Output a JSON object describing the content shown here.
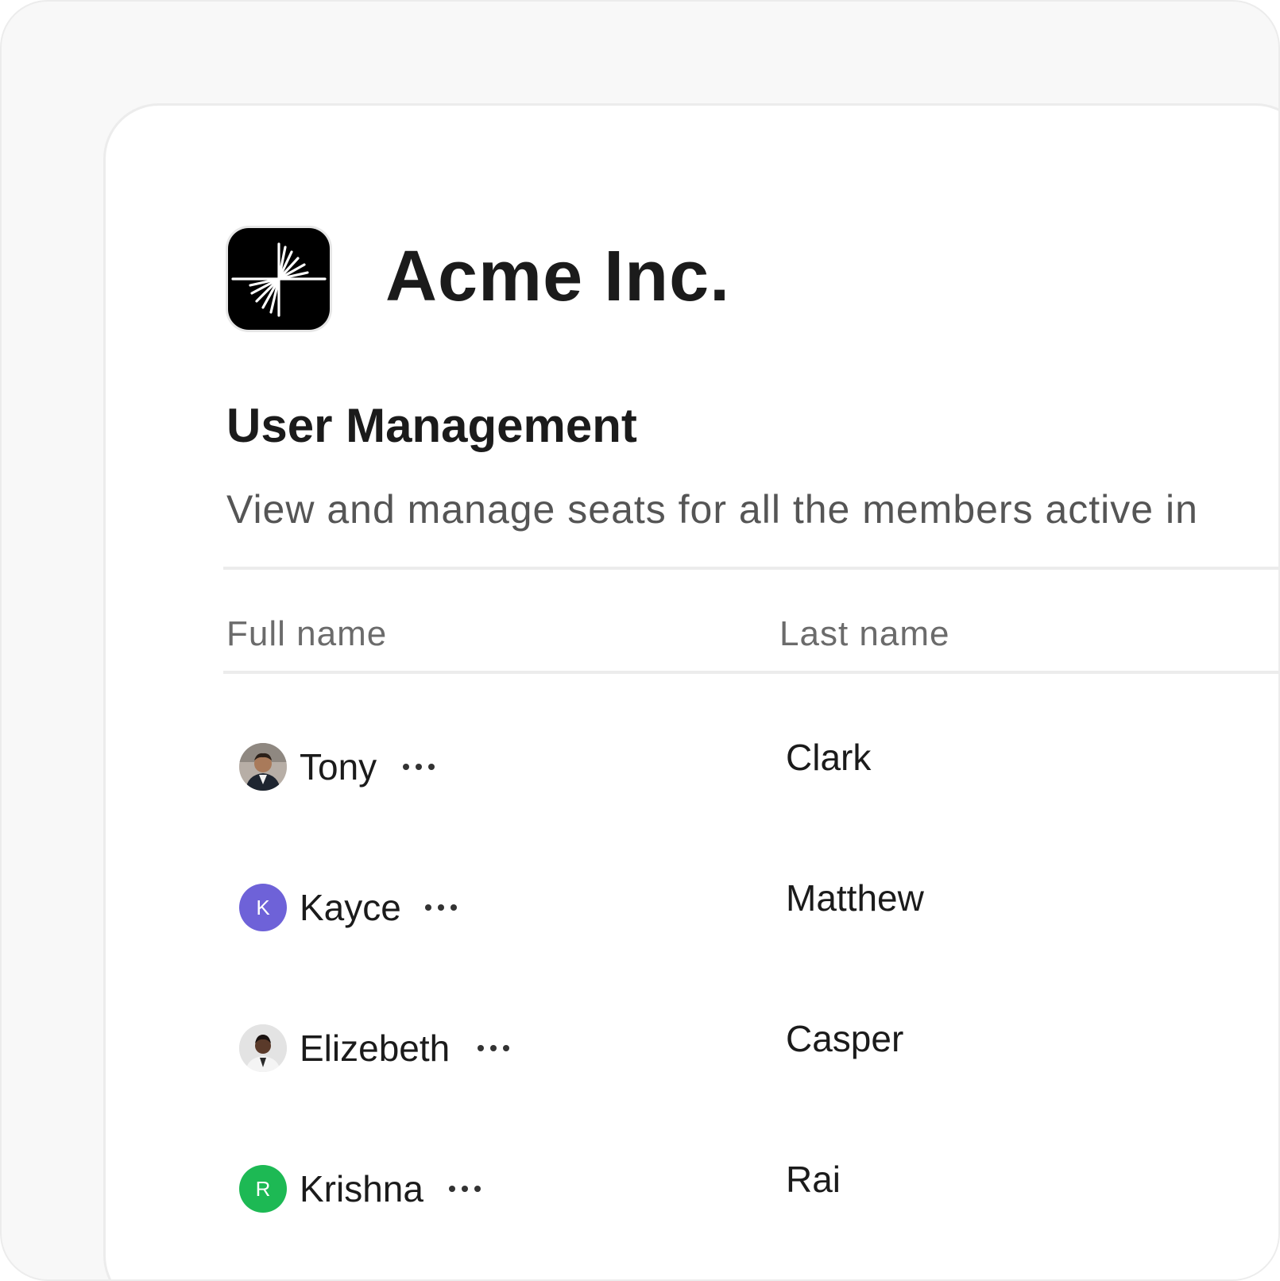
{
  "brand": {
    "company_name": "Acme Inc.",
    "logo_icon": "starburst-logo-icon"
  },
  "section": {
    "title": "User Management",
    "description": "View and manage seats for all the members active in"
  },
  "table": {
    "columns": [
      "Full name",
      "Last name"
    ],
    "rows": [
      {
        "first": "Tony",
        "last": "Clark",
        "avatar_type": "photo",
        "avatar_initial": ""
      },
      {
        "first": "Kayce",
        "last": "Matthew",
        "avatar_type": "initial",
        "avatar_initial": "K",
        "avatar_color": "#6e62d8"
      },
      {
        "first": "Elizebeth",
        "last": "Casper",
        "avatar_type": "photo",
        "avatar_initial": ""
      },
      {
        "first": "Krishna",
        "last": "Rai",
        "avatar_type": "initial",
        "avatar_initial": "R",
        "avatar_color": "#1db954"
      }
    ],
    "row_action_icon": "more-horizontal-icon"
  },
  "colors": {
    "text_primary": "#1b1b1b",
    "text_secondary": "#555555",
    "header_text": "#6b6b6b",
    "divider": "#ececec",
    "frame_bg": "#f8f8f8"
  }
}
